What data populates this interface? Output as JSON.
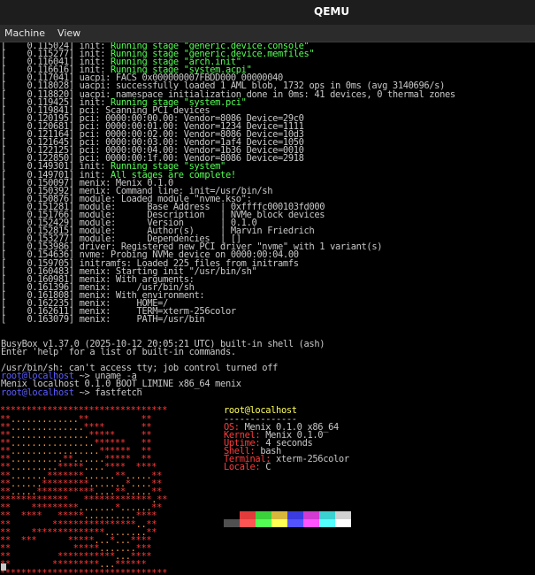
{
  "window": {
    "title": "QEMU"
  },
  "menu": {
    "items": [
      "Machine",
      "View"
    ]
  },
  "boot_log": [
    {
      "t": "[    0.115024]",
      "s": "init: ",
      "h": "Running stage \"generic.device.console\""
    },
    {
      "t": "[    0.115277]",
      "s": "init: ",
      "h": "Running stage \"generic.device.memfiles\""
    },
    {
      "t": "[    0.116041]",
      "s": "init: ",
      "h": "Running stage \"arch.init\""
    },
    {
      "t": "[    0.116616]",
      "s": "init: ",
      "h": "Running stage \"system.acpi\""
    },
    {
      "t": "[    0.117041]",
      "s": "uacpi: FACS 0x000000007FBDD000 00000040",
      "h": ""
    },
    {
      "t": "[    0.118028]",
      "s": "uacpi: successfully loaded 1 AML blob, 1732 ops in 0ms (avg 3140696/s)",
      "h": ""
    },
    {
      "t": "[    0.118820]",
      "s": "uacpi: namespace initialization done in 0ms: 41 devices, 0 thermal zones",
      "h": ""
    },
    {
      "t": "[    0.119425]",
      "s": "init: ",
      "h": "Running stage \"system.pci\""
    },
    {
      "t": "[    0.119841]",
      "s": "pci: Scanning PCI devices",
      "h": ""
    },
    {
      "t": "[    0.120195]",
      "s": "pci: 0000:00:00.00: Vendor=8086 Device=29c0",
      "h": ""
    },
    {
      "t": "[    0.120681]",
      "s": "pci: 0000:00:01.00: Vendor=1234 Device=1111",
      "h": ""
    },
    {
      "t": "[    0.121164]",
      "s": "pci: 0000:00:02.00: Vendor=8086 Device=10d3",
      "h": ""
    },
    {
      "t": "[    0.121645]",
      "s": "pci: 0000:00:03.00: Vendor=1af4 Device=1050",
      "h": ""
    },
    {
      "t": "[    0.122125]",
      "s": "pci: 0000:00:04.00: Vendor=1b36 Device=0010",
      "h": ""
    },
    {
      "t": "[    0.122850]",
      "s": "pci: 0000:00:1f.00: Vendor=8086 Device=2918",
      "h": ""
    },
    {
      "t": "[    0.149301]",
      "s": "init: ",
      "h": "Running stage \"system\""
    },
    {
      "t": "[    0.149701]",
      "s": "init: ",
      "h": "All stages are complete!"
    },
    {
      "t": "[    0.150097]",
      "s": "menix: Menix 0.1.0",
      "h": ""
    },
    {
      "t": "[    0.150392]",
      "s": "menix: Command line: init=/usr/bin/sh",
      "h": ""
    },
    {
      "t": "[    0.150876]",
      "s": "module: Loaded module \"nvme.kso\":",
      "h": ""
    },
    {
      "t": "[    0.151281]",
      "s": "module:      Base Address  | 0xffffc000103fd000",
      "h": ""
    },
    {
      "t": "[    0.151766]",
      "s": "module:      Description   | NVMe block devices",
      "h": ""
    },
    {
      "t": "[    0.152429]",
      "s": "module:      Version       | 0.1.0",
      "h": ""
    },
    {
      "t": "[    0.152815]",
      "s": "module:      Author(s)     | Marvin Friedrich",
      "h": ""
    },
    {
      "t": "[    0.153277]",
      "s": "module:      Dependencies  | []",
      "h": ""
    },
    {
      "t": "[    0.153986]",
      "s": "driver: Registered new PCI driver \"nvme\" with 1 variant(s)",
      "h": ""
    },
    {
      "t": "[    0.154636]",
      "s": "nvme: Probing NVMe device on 0000:00:04.00",
      "h": ""
    },
    {
      "t": "[    0.159705]",
      "s": "initramfs: Loaded 225 files from initramfs",
      "h": ""
    },
    {
      "t": "[    0.160483]",
      "s": "menix: Starting init \"/usr/bin/sh\"",
      "h": ""
    },
    {
      "t": "[    0.160981]",
      "s": "menix: With arguments:",
      "h": ""
    },
    {
      "t": "[    0.161396]",
      "s": "menix:     /usr/bin/sh",
      "h": ""
    },
    {
      "t": "[    0.161808]",
      "s": "menix: With environment:",
      "h": ""
    },
    {
      "t": "[    0.162235]",
      "s": "menix:     HOME=/",
      "h": ""
    },
    {
      "t": "[    0.162611]",
      "s": "menix:     TERM=xterm-256color",
      "h": ""
    },
    {
      "t": "[    0.163079]",
      "s": "menix:     PATH=/usr/bin",
      "h": ""
    }
  ],
  "shell": {
    "banner1": "BusyBox v1.37.0 (2025-10-12 20:05:21 UTC) built-in shell (ash)",
    "banner2": "Enter 'help' for a list of built-in commands.",
    "tty_warning": "/usr/bin/sh: can't access tty; job control turned off",
    "prompt_user": "root@localhost",
    "prompt_suffix": " ~> ",
    "cmd1": "uname -a",
    "uname_output": "Menix localhost 0.1.0 BOOT_LIMINE x86_64 menix",
    "cmd2": "fastfetch"
  },
  "fastfetch": {
    "header": "root@localhost",
    "separator": "--------------",
    "fields": [
      {
        "key": "OS",
        "value": "Menix 0.1.0 x86_64"
      },
      {
        "key": "Kernel",
        "value": "Menix 0.1.0"
      },
      {
        "key": "Uptime",
        "value": "4 seconds"
      },
      {
        "key": "Shell",
        "value": "bash"
      },
      {
        "key": "Terminal",
        "value": "xterm-256color"
      },
      {
        "key": "Locale",
        "value": "C"
      }
    ],
    "palette": [
      "#000000",
      "#e23b3b",
      "#3bd13b",
      "#d8b83b",
      "#3b3be2",
      "#d13bd1",
      "#3bd1d1",
      "#d0d0d0",
      "#505050",
      "#ff5454",
      "#54ff54",
      "#ffff54",
      "#5454ff",
      "#ff54ff",
      "#54ffff",
      "#ffffff"
    ],
    "logo_lines": [
      "********************************",
      "**.............**          **",
      "**..............****       **",
      "**...............*****     **",
      "**................******   **",
      "**.................******  **",
      "**..........**......*****  **",
      "**.........*****....****  ****",
      "**.......*******......**.....**",
      "**......*********.......*....**",
      "**.....***********....**.....**",
      "*************   *************.**",
      "**    *********.......*......**",
      "**  ****   *****..........****",
      "**        ****************..**",
      "**    **************........**",
      "**  ***      *****...*...****",
      "**            *****.......***",
      "**         ***********...****",
      "**        *********...******",
      "********************************"
    ]
  }
}
